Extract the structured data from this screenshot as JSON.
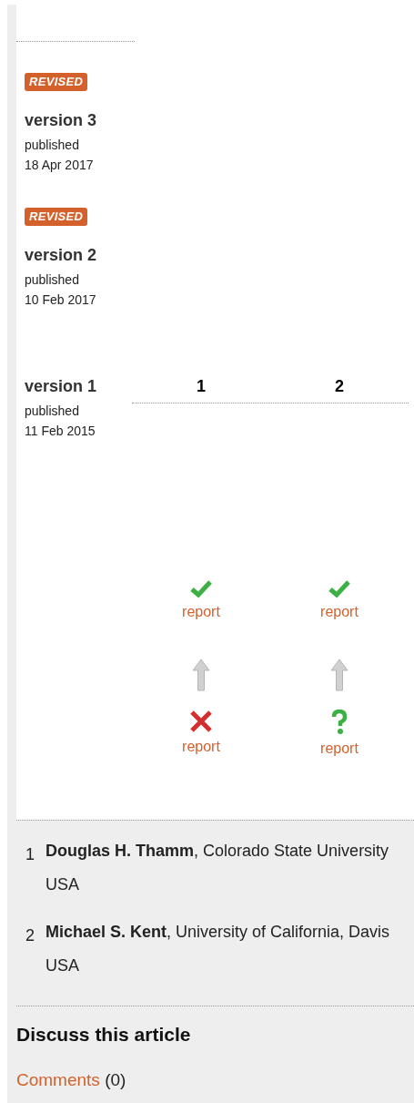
{
  "versions": [
    {
      "badge": "REVISED",
      "title": "version 3",
      "status": "published",
      "date": "18 Apr 2017"
    },
    {
      "badge": "REVISED",
      "title": "version 2",
      "status": "published",
      "date": "10 Feb 2017"
    },
    {
      "title": "version 1",
      "status": "published",
      "date": "11 Feb 2015"
    }
  ],
  "reviewer_columns": [
    "1",
    "2"
  ],
  "report_rows": [
    [
      {
        "kind": "approved",
        "link": "report",
        "arrow": false
      },
      {
        "kind": "approved",
        "link": "report",
        "arrow": false
      }
    ],
    [
      {
        "kind": "not_approved",
        "link": "report",
        "arrow": true
      },
      {
        "kind": "reservations",
        "link": "report",
        "arrow": true
      }
    ]
  ],
  "reviewers": [
    {
      "number": "1",
      "text": "**Douglas H. Thamm**, Colorado State University USA"
    },
    {
      "number": "2",
      "text": "**Michael S. Kent**, University of California, Davis USA"
    }
  ],
  "discuss": {
    "title": "Discuss this article",
    "link": "Comments",
    "count": "(0)"
  }
}
